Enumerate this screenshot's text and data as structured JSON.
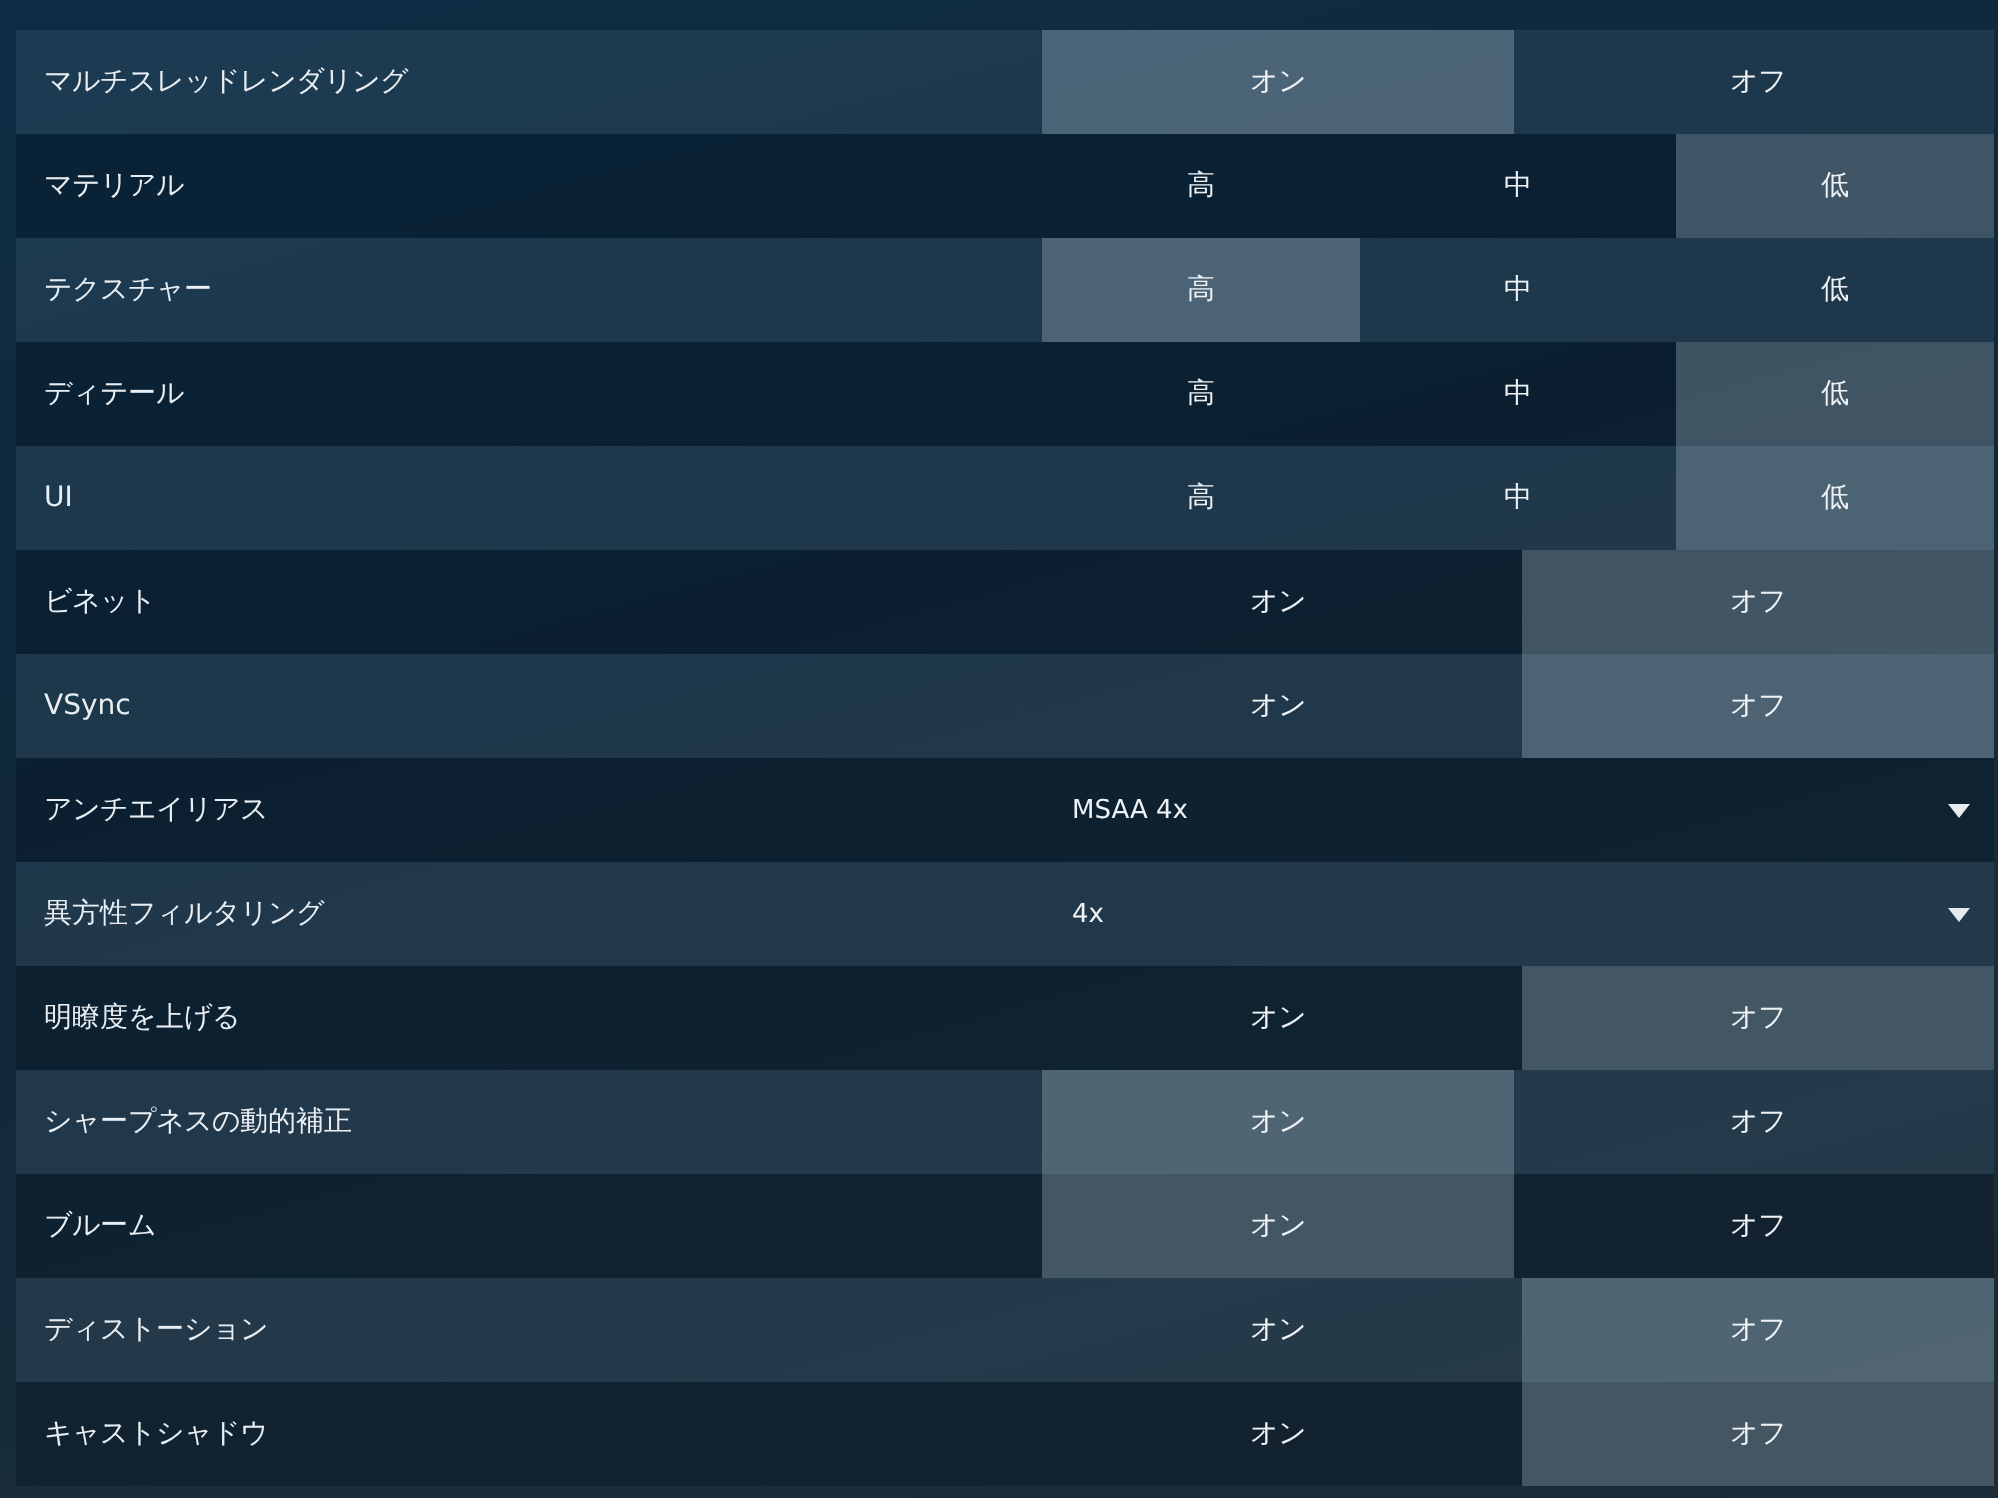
{
  "settings": [
    {
      "kind": "choice",
      "label": "マルチスレッドレンダリング",
      "options": [
        {
          "label": "オン",
          "selected": true
        },
        {
          "label": "オフ",
          "selected": false
        }
      ]
    },
    {
      "kind": "choice",
      "label": "マテリアル",
      "options": [
        {
          "label": "高",
          "selected": false
        },
        {
          "label": "中",
          "selected": false
        },
        {
          "label": "低",
          "selected": true
        }
      ]
    },
    {
      "kind": "choice",
      "label": "テクスチャー",
      "options": [
        {
          "label": "高",
          "selected": true
        },
        {
          "label": "中",
          "selected": false
        },
        {
          "label": "低",
          "selected": false
        }
      ]
    },
    {
      "kind": "choice",
      "label": "ディテール",
      "options": [
        {
          "label": "高",
          "selected": false
        },
        {
          "label": "中",
          "selected": false
        },
        {
          "label": "低",
          "selected": true
        }
      ]
    },
    {
      "kind": "choice",
      "label": "UI",
      "options": [
        {
          "label": "高",
          "selected": false
        },
        {
          "label": "中",
          "selected": false
        },
        {
          "label": "低",
          "selected": true
        }
      ]
    },
    {
      "kind": "choice",
      "label": "ビネット",
      "options": [
        {
          "label": "オン",
          "selected": false
        },
        {
          "label": "オフ",
          "selected": true
        }
      ]
    },
    {
      "kind": "choice",
      "label": "VSync",
      "options": [
        {
          "label": "オン",
          "selected": false
        },
        {
          "label": "オフ",
          "selected": true
        }
      ]
    },
    {
      "kind": "dropdown",
      "label": "アンチエイリアス",
      "value": "MSAA 4x"
    },
    {
      "kind": "dropdown",
      "label": "異方性フィルタリング",
      "value": "4x"
    },
    {
      "kind": "choice",
      "label": "明瞭度を上げる",
      "options": [
        {
          "label": "オン",
          "selected": false
        },
        {
          "label": "オフ",
          "selected": true
        }
      ]
    },
    {
      "kind": "choice",
      "label": "シャープネスの動的補正",
      "options": [
        {
          "label": "オン",
          "selected": true
        },
        {
          "label": "オフ",
          "selected": false
        }
      ]
    },
    {
      "kind": "choice",
      "label": "ブルーム",
      "options": [
        {
          "label": "オン",
          "selected": true
        },
        {
          "label": "オフ",
          "selected": false
        }
      ]
    },
    {
      "kind": "choice",
      "label": "ディストーション",
      "options": [
        {
          "label": "オン",
          "selected": false
        },
        {
          "label": "オフ",
          "selected": true
        }
      ]
    },
    {
      "kind": "choice",
      "label": "キャストシャドウ",
      "options": [
        {
          "label": "オン",
          "selected": false
        },
        {
          "label": "オフ",
          "selected": true
        }
      ]
    }
  ]
}
